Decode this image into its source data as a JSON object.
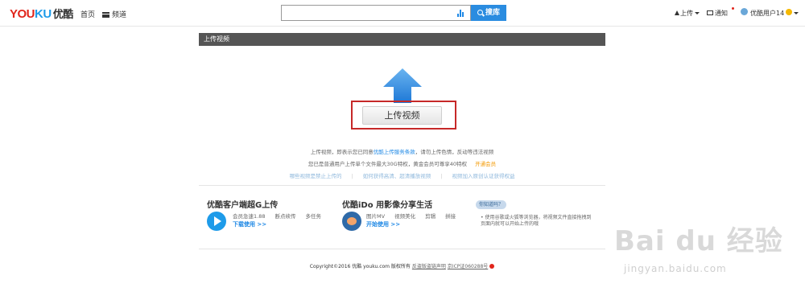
{
  "header": {
    "logo": {
      "y": "YOU",
      "k": "KU",
      "cn": "优酷"
    },
    "nav": {
      "home": "首页",
      "channels": "频道"
    },
    "search": {
      "placeholder": "",
      "button": "搜库"
    },
    "right": {
      "upload": "上传",
      "notify": "通知",
      "user": "优酷用户14"
    }
  },
  "main": {
    "title": "上传视频",
    "upload_button": "上传视频",
    "info_line1": {
      "prefix": "上传视频，即表示您已同意",
      "link": "优酷上传服务条款",
      "suffix": "，请勿上传色情，反动等违法视频"
    },
    "info_line2": {
      "prefix": "您已是普通用户上传单个文件最大30G特权，黄金会员可尊享40特权",
      "vip": "开通会员"
    },
    "links": [
      "哪些视频是禁止上传的",
      "如何获得高清、超清播放视频",
      "视频加入原创认证获得权益"
    ]
  },
  "promos": {
    "client": {
      "title": "优酷客户端超G上传",
      "features": [
        "会员急速1.88",
        "断点续传",
        "多任务"
      ],
      "link": "下载使用 >>"
    },
    "ido": {
      "title": "优酷iDo 用影像分享生活",
      "features": [
        "图片MV",
        "视频美化",
        "剪辑",
        "拼接"
      ],
      "link": "开始使用 >>"
    },
    "tip": {
      "badge": "你知道吗？",
      "text_line1": "• 使用谷歌或火狐等浏览器，将视频文件直接拖拽到",
      "text_line2": "页面内就可以开始上传的哦"
    }
  },
  "footer": {
    "copyright": "Copyright©2016 优酷 youku.com 版权所有",
    "links": [
      "反盗版盗链声明",
      "京ICP证060288号"
    ]
  },
  "watermark": {
    "text": "Bai du 经验",
    "url": "jingyan.baidu.com"
  },
  "colors": {
    "accent": "#2a8ce0",
    "logo_red": "#e1251b",
    "highlight_frame": "#c62828",
    "vip": "#f39800"
  }
}
